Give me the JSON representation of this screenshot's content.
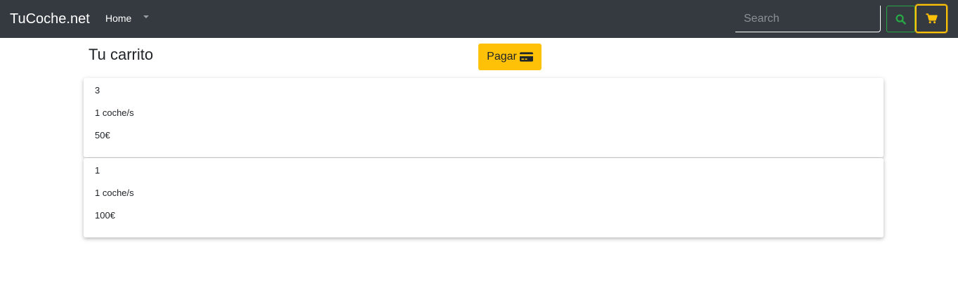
{
  "navbar": {
    "brand": "TuCoche.net",
    "home_label": "Home",
    "search_placeholder": "Search",
    "colors": {
      "background": "#343a40",
      "search_accent": "#28a745",
      "cart_accent": "#ffc107"
    },
    "icons": {
      "dropdown": "caret-down-icon",
      "search": "search-icon",
      "cart": "cart-icon"
    }
  },
  "main": {
    "title": "Tu carrito",
    "pay_label": "Pagar",
    "pay_icon": "credit-card-icon",
    "pay_color": "#ffc107"
  },
  "cart_items": [
    {
      "id": "3",
      "quantity": "1 coche/s",
      "price": "50€"
    },
    {
      "id": "1",
      "quantity": "1 coche/s",
      "price": "100€"
    }
  ]
}
